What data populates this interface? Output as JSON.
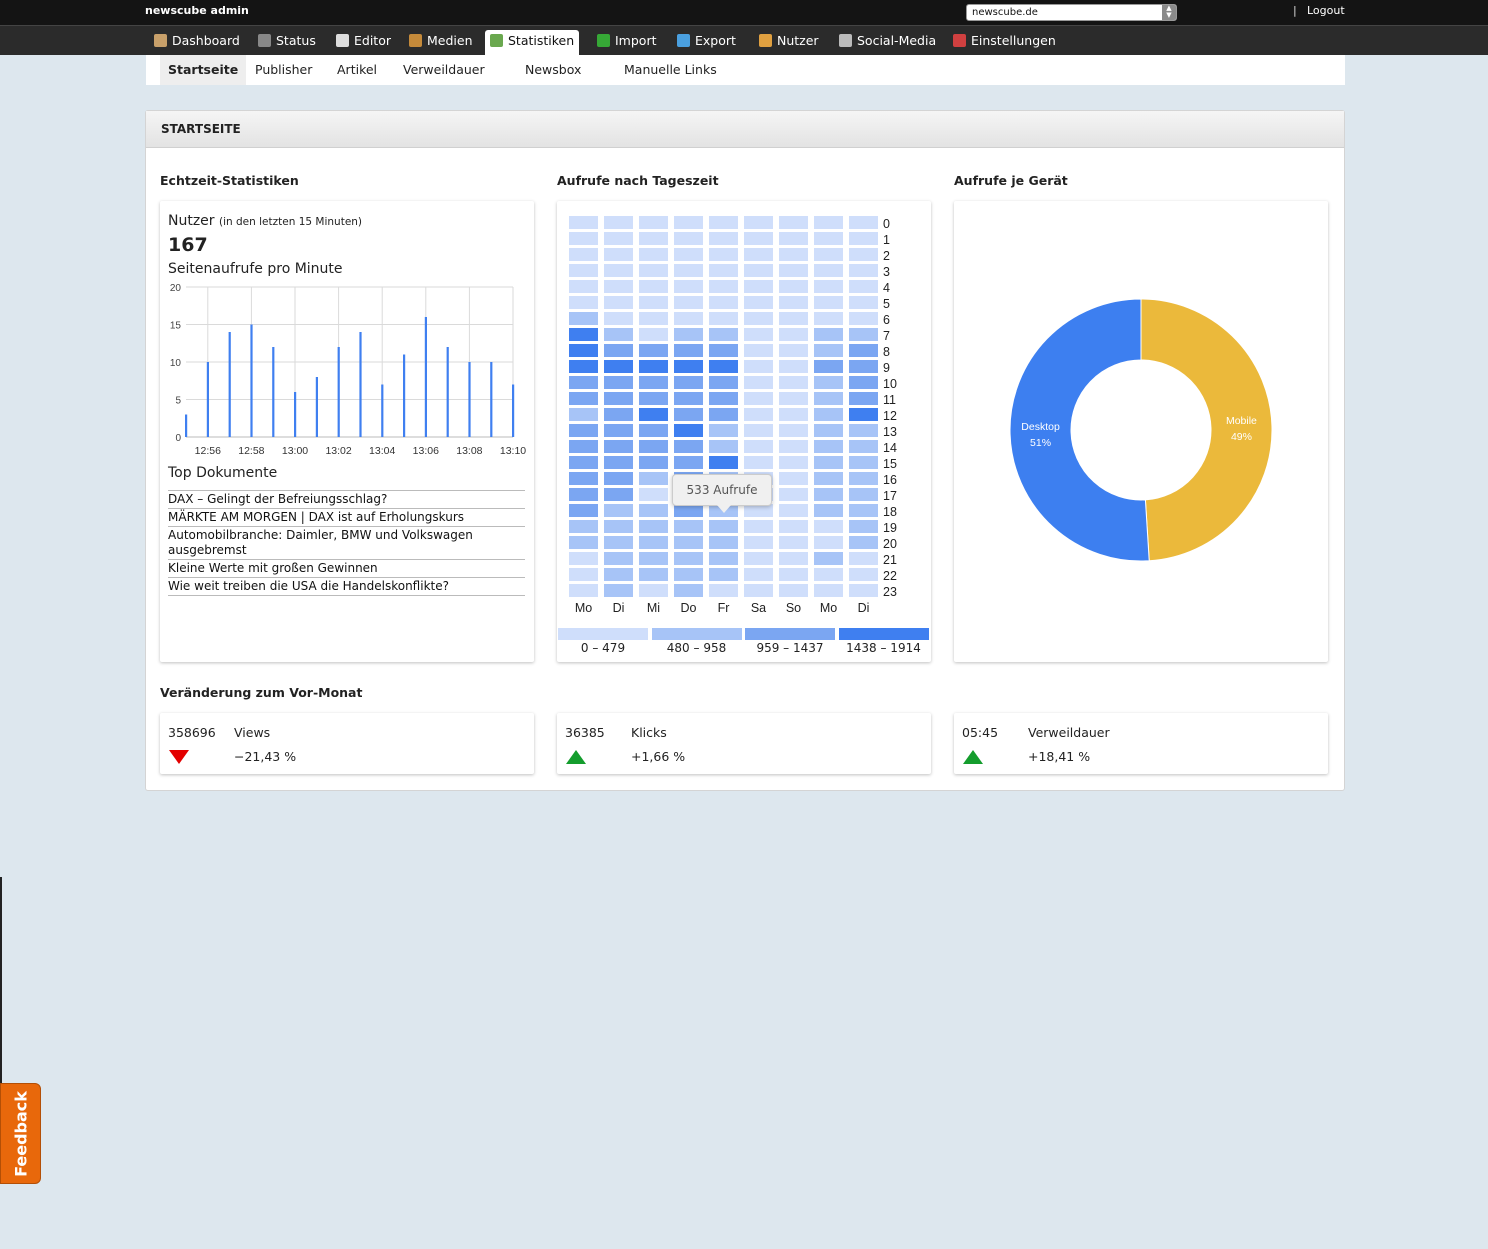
{
  "app": {
    "title": "newscube admin"
  },
  "site_select": {
    "value": "newscube.de"
  },
  "logout": {
    "separator": "|",
    "label": "Logout"
  },
  "main_nav": [
    {
      "label": "Dashboard",
      "icon": "house-icon"
    },
    {
      "label": "Status",
      "icon": "gauge-icon"
    },
    {
      "label": "Editor",
      "icon": "document-edit-icon"
    },
    {
      "label": "Medien",
      "icon": "media-icon"
    },
    {
      "label": "Statistiken",
      "icon": "bar-chart-icon",
      "active": true
    },
    {
      "label": "Import",
      "icon": "import-arrows-icon"
    },
    {
      "label": "Export",
      "icon": "export-arrows-icon"
    },
    {
      "label": "Nutzer",
      "icon": "user-icon"
    },
    {
      "label": "Social-Media",
      "icon": "newspaper-icon"
    },
    {
      "label": "Einstellungen",
      "icon": "tools-icon"
    }
  ],
  "sub_nav": [
    {
      "label": "Startseite",
      "active": true
    },
    {
      "label": "Publisher"
    },
    {
      "label": "Artikel"
    },
    {
      "label": "Verweildauer"
    },
    {
      "label": "Newsbox"
    },
    {
      "label": "Manuelle Links"
    }
  ],
  "panel": {
    "title": "STARTSEITE"
  },
  "realtime": {
    "section_title": "Echtzeit-Statistiken",
    "users_label": "Nutzer",
    "users_note": "(in den letzten 15 Minuten)",
    "users_value": "167",
    "pageviews_label": "Seitenaufrufe pro Minute",
    "top_docs_title": "Top Dokumente",
    "top_docs": [
      "DAX – Gelingt der Befreiungsschlag?",
      "MÄRKTE AM MORGEN | DAX ist auf Erholungskurs",
      "Automobilbranche: Daimler, BMW und Volkswagen ausgebremst",
      "Kleine Werte mit großen Gewinnen",
      "Wie weit treiben die USA die Handelskonflikte?"
    ]
  },
  "heatmap": {
    "section_title": "Aufrufe nach Tageszeit",
    "days": [
      "Mo",
      "Di",
      "Mi",
      "Do",
      "Fr",
      "Sa",
      "So",
      "Mo",
      "Di"
    ],
    "hours": [
      "0",
      "1",
      "2",
      "3",
      "4",
      "5",
      "6",
      "7",
      "8",
      "9",
      "10",
      "11",
      "12",
      "13",
      "14",
      "15",
      "16",
      "17",
      "18",
      "19",
      "20",
      "21",
      "22",
      "23"
    ],
    "legend": [
      "0 – 479",
      "480 – 958",
      "959 – 1437",
      "1438 – 1914"
    ],
    "colors": [
      "#cfdefb",
      "#a7c4f7",
      "#7ba6f2",
      "#3f7ff0"
    ],
    "tooltip": "533 Aufrufe"
  },
  "device": {
    "section_title": "Aufrufe je Gerät"
  },
  "changes": {
    "section_title": "Veränderung zum Vor-Monat",
    "items": [
      {
        "value": "358696",
        "label": "Views",
        "pct": "−21,43 %",
        "direction": "down"
      },
      {
        "value": "36385",
        "label": "Klicks",
        "pct": "+1,66 %",
        "direction": "up"
      },
      {
        "value": "05:45",
        "label": "Verweildauer",
        "pct": "+18,41 %",
        "direction": "up"
      }
    ]
  },
  "feedback": {
    "label": "Feedback"
  },
  "chart_data": [
    {
      "type": "bar",
      "title": "Seitenaufrufe pro Minute",
      "categories": [
        "12:55",
        "",
        "12:56",
        "",
        "12:57",
        "",
        "12:58",
        "",
        "12:59",
        "",
        "13:00",
        "",
        "13:01",
        "",
        "13:02",
        "",
        "13:03",
        "",
        "13:04",
        "",
        "13:05",
        "",
        "13:06",
        "",
        "13:07",
        "",
        "13:08",
        "",
        "13:09",
        "",
        "13:10"
      ],
      "values": [
        3,
        0,
        10,
        0,
        14,
        0,
        15,
        0,
        12,
        0,
        6,
        0,
        8,
        0,
        12,
        0,
        14,
        0,
        7,
        0,
        11,
        0,
        16,
        0,
        12,
        0,
        10,
        0,
        10,
        0,
        7
      ],
      "tick_labels_x": [
        "12:56",
        "12:58",
        "13:00",
        "13:02",
        "13:04",
        "13:06",
        "13:08",
        "13:10"
      ],
      "yticks": [
        "0",
        "5",
        "10",
        "15",
        "20"
      ],
      "ylim": [
        0,
        20
      ],
      "grid": true,
      "color": "#3f7ff0"
    },
    {
      "type": "heatmap",
      "title": "Aufrufe nach Tageszeit",
      "x": [
        "Mo",
        "Di",
        "Mi",
        "Do",
        "Fr",
        "Sa",
        "So",
        "Mo",
        "Di"
      ],
      "y": [
        "0",
        "1",
        "2",
        "3",
        "4",
        "5",
        "6",
        "7",
        "8",
        "9",
        "10",
        "11",
        "12",
        "13",
        "14",
        "15",
        "16",
        "17",
        "18",
        "19",
        "20",
        "21",
        "22",
        "23"
      ],
      "bins": [
        "0 – 479",
        "480 – 958",
        "959 – 1437",
        "1438 – 1914"
      ],
      "levels": [
        [
          0,
          0,
          0,
          0,
          0,
          0,
          0,
          0,
          0
        ],
        [
          0,
          0,
          0,
          0,
          0,
          0,
          0,
          0,
          0
        ],
        [
          0,
          0,
          0,
          0,
          0,
          0,
          0,
          0,
          0
        ],
        [
          0,
          0,
          0,
          0,
          0,
          0,
          0,
          0,
          0
        ],
        [
          0,
          0,
          0,
          0,
          0,
          0,
          0,
          0,
          0
        ],
        [
          0,
          0,
          0,
          0,
          0,
          0,
          0,
          0,
          0
        ],
        [
          1,
          0,
          0,
          0,
          0,
          0,
          0,
          0,
          0
        ],
        [
          3,
          1,
          0,
          1,
          1,
          0,
          0,
          1,
          1
        ],
        [
          3,
          2,
          2,
          2,
          2,
          0,
          0,
          1,
          2
        ],
        [
          3,
          3,
          3,
          3,
          3,
          0,
          0,
          2,
          2
        ],
        [
          2,
          2,
          2,
          2,
          2,
          0,
          0,
          1,
          2
        ],
        [
          2,
          2,
          2,
          2,
          2,
          0,
          0,
          1,
          2
        ],
        [
          1,
          2,
          3,
          2,
          2,
          0,
          0,
          1,
          3
        ],
        [
          2,
          2,
          2,
          3,
          1,
          0,
          0,
          1,
          1
        ],
        [
          2,
          2,
          2,
          2,
          1,
          0,
          0,
          1,
          1
        ],
        [
          2,
          2,
          2,
          2,
          3,
          0,
          0,
          1,
          1
        ],
        [
          2,
          2,
          1,
          2,
          1,
          0,
          0,
          1,
          1
        ],
        [
          2,
          2,
          0,
          2,
          1,
          0,
          0,
          1,
          1
        ],
        [
          2,
          1,
          1,
          2,
          1,
          0,
          0,
          1,
          1
        ],
        [
          1,
          1,
          1,
          1,
          1,
          0,
          0,
          0,
          1
        ],
        [
          1,
          1,
          1,
          1,
          1,
          0,
          0,
          0,
          1
        ],
        [
          0,
          1,
          1,
          1,
          1,
          0,
          0,
          1,
          0
        ],
        [
          0,
          1,
          1,
          1,
          1,
          0,
          0,
          0,
          0
        ],
        [
          0,
          1,
          0,
          1,
          0,
          0,
          0,
          0,
          0
        ]
      ]
    },
    {
      "type": "pie",
      "title": "Aufrufe je Gerät",
      "donut": true,
      "slices": [
        {
          "label": "Desktop",
          "value": 51,
          "value_label": "51%",
          "color": "#3d7ff0"
        },
        {
          "label": "Mobile",
          "value": 49,
          "value_label": "49%",
          "color": "#ebb93b"
        }
      ]
    }
  ]
}
